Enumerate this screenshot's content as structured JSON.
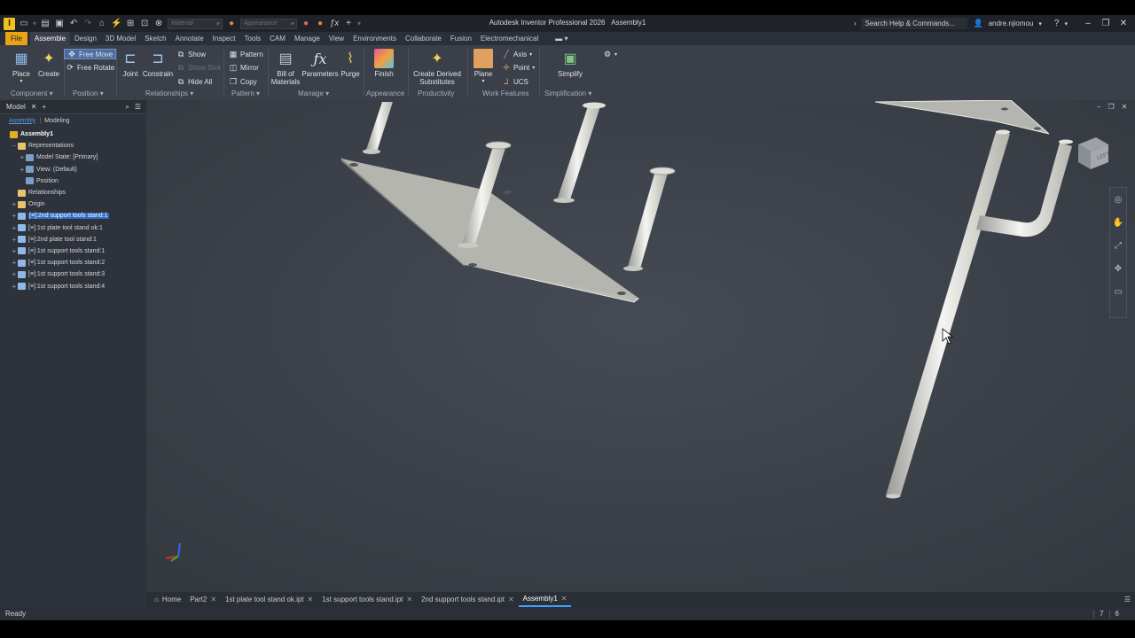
{
  "app": {
    "title": "Autodesk Inventor Professional 2026",
    "document": "Assembly1",
    "search_placeholder": "Search Help & Commands...",
    "user": "andre.njiomou",
    "material_placeholder": "Material",
    "appearance_placeholder": "Appearance"
  },
  "menu_tabs": [
    "File",
    "Assemble",
    "Design",
    "3D Model",
    "Sketch",
    "Annotate",
    "Inspect",
    "Tools",
    "CAM",
    "Manage",
    "View",
    "Environments",
    "Collaborate",
    "Fusion",
    "Electromechanical"
  ],
  "ribbon": {
    "component": {
      "title": "Component",
      "place": "Place",
      "create": "Create"
    },
    "position": {
      "title": "Position",
      "free_move": "Free Move",
      "free_rotate": "Free Rotate"
    },
    "relationships": {
      "title": "Relationships",
      "joint": "Joint",
      "constrain": "Constrain",
      "show": "Show",
      "show_sick": "Show Sick",
      "hide_all": "Hide All"
    },
    "pattern": {
      "title": "Pattern",
      "pattern": "Pattern",
      "mirror": "Mirror",
      "copy": "Copy"
    },
    "manage": {
      "title": "Manage",
      "bom": "Bill of\nMaterials",
      "bom_l1": "Bill of",
      "bom_l2": "Materials",
      "parameters": "Parameters",
      "purge": "Purge"
    },
    "appearance": {
      "title": "Appearance",
      "finish": "Finish"
    },
    "productivity": {
      "title": "Productivity",
      "cds_l1": "Create Derived",
      "cds_l2": "Substitutes"
    },
    "work_features": {
      "title": "Work Features",
      "plane": "Plane",
      "axis": "Axis",
      "point": "Point",
      "ucs": "UCS"
    },
    "simplification": {
      "title": "Simplification",
      "simplify": "Simplify"
    }
  },
  "browser": {
    "tab": "Model",
    "sub_assembly": "Assembly",
    "sub_modeling": "Modeling",
    "tree": [
      {
        "label": "Assembly1",
        "indent": 0,
        "pm": ""
      },
      {
        "label": "Representations",
        "indent": 1,
        "pm": "−"
      },
      {
        "label": "Model State: [Primary]",
        "indent": 2,
        "pm": "+"
      },
      {
        "label": "View: (Default)",
        "indent": 2,
        "pm": "+"
      },
      {
        "label": "Position",
        "indent": 2,
        "pm": ""
      },
      {
        "label": "Relationships",
        "indent": 1,
        "pm": ""
      },
      {
        "label": "Origin",
        "indent": 1,
        "pm": "+"
      },
      {
        "label": "[≡]:2nd support tools stand:1",
        "indent": 1,
        "pm": "+"
      },
      {
        "label": "[≡]:1st plate tool stand ok:1",
        "indent": 1,
        "pm": "+"
      },
      {
        "label": "[≡]:2nd plate tool stand:1",
        "indent": 1,
        "pm": "+"
      },
      {
        "label": "[≡]:1st support tools stand:1",
        "indent": 1,
        "pm": "+"
      },
      {
        "label": "[≡]:1st support tools stand:2",
        "indent": 1,
        "pm": "+"
      },
      {
        "label": "[≡]:1st support tools stand:3",
        "indent": 1,
        "pm": "+"
      },
      {
        "label": "[≡]:1st support tools stand:4",
        "indent": 1,
        "pm": "+"
      }
    ]
  },
  "doc_tabs": [
    "Home",
    "Part2",
    "1st plate tool stand ok.ipt",
    "1st support tools stand.ipt",
    "2nd support tools stand.ipt",
    "Assembly1"
  ],
  "status": {
    "text": "Ready",
    "count1": "7",
    "count2": "6"
  },
  "viewcube": {
    "face": "LEFT"
  },
  "colors": {
    "accent": "#e8a317",
    "selection": "#2d6dc5",
    "active_tab_underline": "#3ea0ff",
    "viewport_bg": "#3d424c"
  }
}
